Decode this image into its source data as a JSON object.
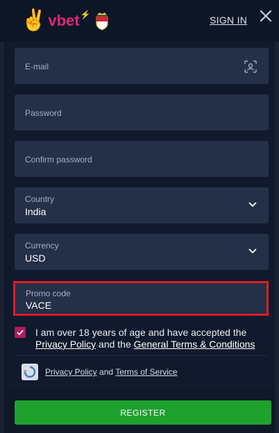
{
  "header": {
    "logo_text": "vbet",
    "sign_in": "SIGN IN"
  },
  "form": {
    "email_placeholder": "E-mail",
    "password_placeholder": "Password",
    "confirm_password_placeholder": "Confirm password",
    "country_label": "Country",
    "country_value": "India",
    "currency_label": "Currency",
    "currency_value": "USD",
    "promo_label": "Promo code",
    "promo_value": "VACE"
  },
  "consent": {
    "checked": true,
    "prefix": "I am over 18 years of age and have accepted the",
    "privacy_link": "Privacy Policy",
    "and": "and the",
    "terms_link": "General Terms & Conditions"
  },
  "recaptcha": {
    "privacy": "Privacy Policy",
    "and": "and",
    "terms": "Terms of Service"
  },
  "actions": {
    "register": "REGISTER"
  },
  "colors": {
    "brand": "#e0247a",
    "register": "#1fa12e",
    "promo_highlight": "#e11d25"
  }
}
